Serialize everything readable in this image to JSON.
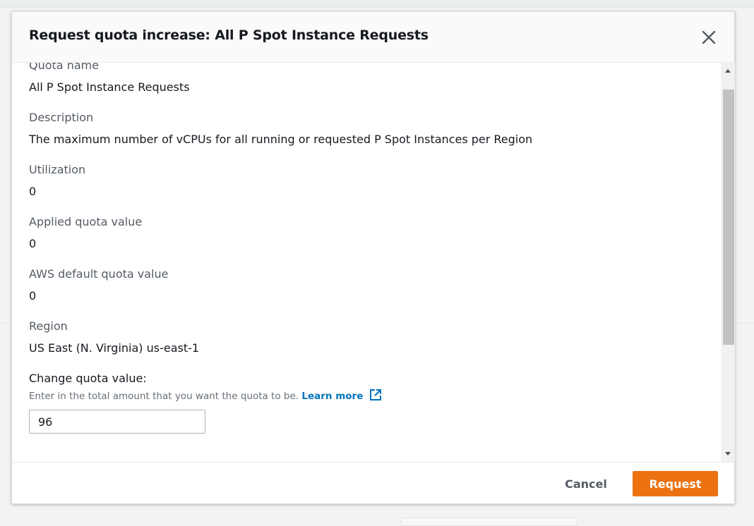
{
  "modal": {
    "title": "Request quota increase: All P Spot Instance Requests"
  },
  "fields": [
    {
      "label": "Quota name",
      "value": "All P Spot Instance Requests"
    },
    {
      "label": "Description",
      "value": "The maximum number of vCPUs for all running or requested P Spot Instances per Region"
    },
    {
      "label": "Utilization",
      "value": "0"
    },
    {
      "label": "Applied quota value",
      "value": "0"
    },
    {
      "label": "AWS default quota value",
      "value": "0"
    },
    {
      "label": "Region",
      "value": "US East (N. Virginia) us-east-1"
    }
  ],
  "change_quota": {
    "label": "Change quota value:",
    "help_text": "Enter in the total amount that you want the quota to be.",
    "learn_more": "Learn more",
    "input_value": "96"
  },
  "footer": {
    "cancel_label": "Cancel",
    "request_label": "Request"
  },
  "colors": {
    "primary_button": "#ec7211",
    "link": "#0073bb"
  },
  "icons": {
    "close": "close-icon",
    "external_link": "external-link-icon",
    "scroll_up": "scroll-up-arrow-icon",
    "scroll_down": "scroll-down-arrow-icon"
  }
}
